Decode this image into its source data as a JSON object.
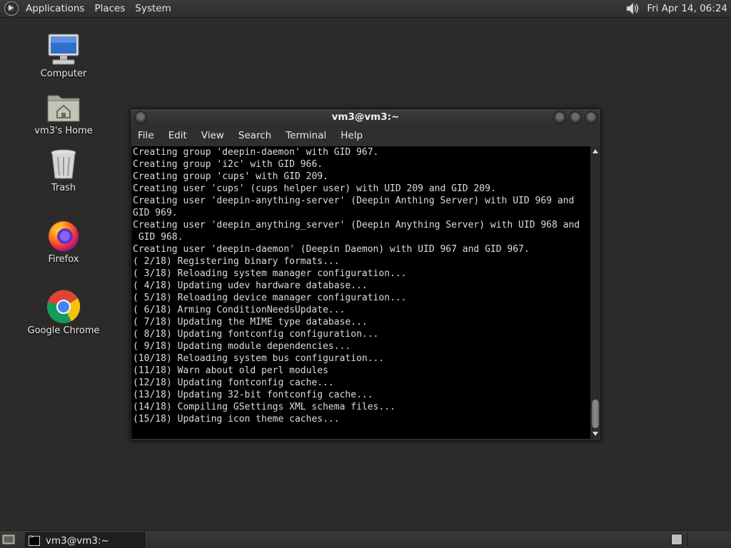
{
  "top_panel": {
    "menus": [
      "Applications",
      "Places",
      "System"
    ],
    "clock": "Fri Apr 14, 06:24"
  },
  "desktop_icons": [
    {
      "label": "Computer",
      "icon": "computer-icon"
    },
    {
      "label": "vm3's Home",
      "icon": "home-folder-icon"
    },
    {
      "label": "Trash",
      "icon": "trash-icon"
    },
    {
      "label": "Firefox",
      "icon": "firefox-icon"
    },
    {
      "label": "Google Chrome",
      "icon": "chrome-icon"
    }
  ],
  "terminal": {
    "title": "vm3@vm3:~",
    "menu": [
      "File",
      "Edit",
      "View",
      "Search",
      "Terminal",
      "Help"
    ],
    "lines": [
      "Creating group 'deepin-daemon' with GID 967.",
      "Creating group 'i2c' with GID 966.",
      "Creating group 'cups' with GID 209.",
      "Creating user 'cups' (cups helper user) with UID 209 and GID 209.",
      "Creating user 'deepin-anything-server' (Deepin Anthing Server) with UID 969 and",
      "GID 969.",
      "Creating user 'deepin_anything_server' (Deepin Anything Server) with UID 968 and",
      " GID 968.",
      "Creating user 'deepin-daemon' (Deepin Daemon) with UID 967 and GID 967.",
      "( 2/18) Registering binary formats...",
      "( 3/18) Reloading system manager configuration...",
      "( 4/18) Updating udev hardware database...",
      "( 5/18) Reloading device manager configuration...",
      "( 6/18) Arming ConditionNeedsUpdate...",
      "( 7/18) Updating the MIME type database...",
      "( 8/18) Updating fontconfig configuration...",
      "( 9/18) Updating module dependencies...",
      "(10/18) Reloading system bus configuration...",
      "(11/18) Warn about old perl modules",
      "(12/18) Updating fontconfig cache...",
      "(13/18) Updating 32-bit fontconfig cache...",
      "(14/18) Compiling GSettings XML schema files...",
      "(15/18) Updating icon theme caches..."
    ]
  },
  "taskbar": {
    "task_label": "vm3@vm3:~"
  }
}
